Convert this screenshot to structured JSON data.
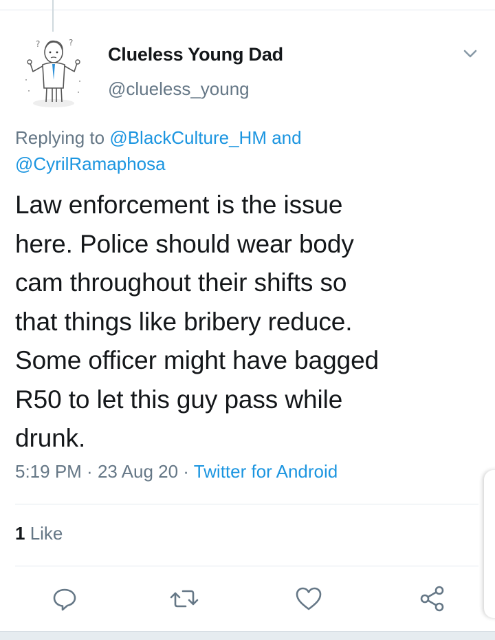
{
  "user": {
    "display_name": "Clueless Young Dad",
    "handle": "@clueless_young"
  },
  "reply": {
    "prefix": "Replying to ",
    "mention1": "@BlackCulture_HM",
    "joiner": " and ",
    "mention2": "@CyrilRamaphosa"
  },
  "tweet": {
    "text": "Law enforcement is the issue\nhere. Police should wear body\ncam throughout their shifts so\nthat things like bribery reduce.\nSome officer might have bagged\nR50 to let this guy pass while\ndrunk."
  },
  "meta": {
    "time": "5:19 PM",
    "sep1": " · ",
    "date": "23 Aug 20",
    "sep2": " · ",
    "source": "Twitter for Android"
  },
  "stats": {
    "likes_count": "1",
    "likes_label": " Like"
  },
  "icons": {
    "reply": "reply-icon",
    "retweet": "retweet-icon",
    "like": "heart-icon",
    "share": "share-icon",
    "menu": "chevron-down-icon"
  },
  "colors": {
    "link": "#1b95e0",
    "secondary": "#657786",
    "text": "#14171a",
    "divider": "#e1e8ed"
  }
}
